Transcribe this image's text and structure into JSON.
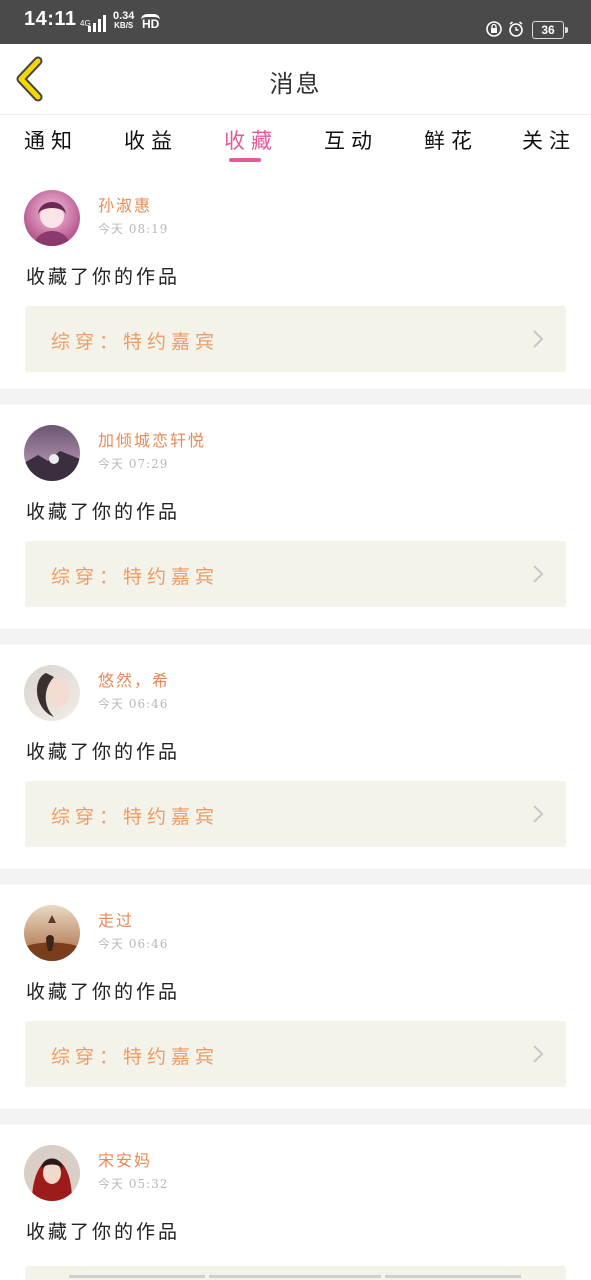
{
  "status_bar": {
    "time": "14:11",
    "network": "4G",
    "speed_value": "0.34",
    "speed_unit": "KB/S",
    "hd": "HD",
    "battery": "36",
    "icons": [
      "signal-icon",
      "lock-rotation-icon",
      "alarm-icon",
      "battery-icon"
    ]
  },
  "header": {
    "title": "消息",
    "back_icon": "chevron-left-icon",
    "back_color": "#f5d800"
  },
  "tabs": [
    {
      "label": "通知",
      "active": false
    },
    {
      "label": "收益",
      "active": false
    },
    {
      "label": "收藏",
      "active": true
    },
    {
      "label": "互动",
      "active": false
    },
    {
      "label": "鲜花",
      "active": false
    },
    {
      "label": "关注",
      "active": false
    }
  ],
  "colors": {
    "accent": "#e75a99",
    "username": "#e98a55",
    "work_title": "#ee9c67",
    "work_box_bg": "#f4f3ea",
    "divider_bg": "#f5f3f1"
  },
  "messages": [
    {
      "username": "孙淑惠",
      "time": "今天 08:19",
      "action": "收藏了你的作品",
      "work": "综穿：特约嘉宾"
    },
    {
      "username": "加倾城恋轩悦",
      "time": "今天 07:29",
      "action": "收藏了你的作品",
      "work": "综穿：特约嘉宾"
    },
    {
      "username": "悠然，希",
      "time": "今天 06:46",
      "action": "收藏了你的作品",
      "work": "综穿：特约嘉宾"
    },
    {
      "username": "走过",
      "time": "今天 06:46",
      "action": "收藏了你的作品",
      "work": "综穿：特约嘉宾"
    },
    {
      "username": "宋安妈",
      "time": "今天 05:32",
      "action": "收藏了你的作品",
      "work": ""
    }
  ]
}
